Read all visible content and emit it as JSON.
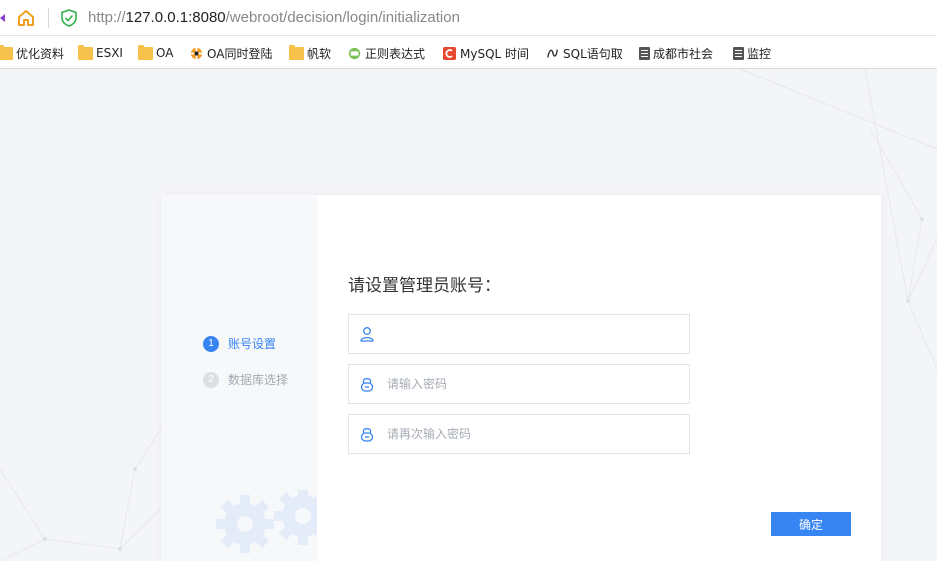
{
  "browser": {
    "url_prefix": "http://",
    "url_host": "127.0.0.1:8080",
    "url_path": "/webroot/decision/login/initialization"
  },
  "bookmarks": [
    {
      "label": "优化资料",
      "icon": "folder-icon"
    },
    {
      "label": "ESXI",
      "icon": "folder-icon"
    },
    {
      "label": "OA",
      "icon": "folder-icon"
    },
    {
      "label": "OA同时登陆",
      "icon": "oa-logo-icon"
    },
    {
      "label": "帆软",
      "icon": "folder-icon"
    },
    {
      "label": "正则表达式",
      "icon": "regex-logo-icon"
    },
    {
      "label": "MySQL 时间",
      "icon": "c-logo-icon"
    },
    {
      "label": "SQL语句取",
      "icon": "sql-logo-icon"
    },
    {
      "label": "成都市社会",
      "icon": "document-icon"
    },
    {
      "label": "监控",
      "icon": "document-icon"
    }
  ],
  "steps": [
    {
      "number": "1",
      "label": "账号设置",
      "state": "active"
    },
    {
      "number": "2",
      "label": "数据库选择",
      "state": "inactive"
    }
  ],
  "form": {
    "heading": "请设置管理员账号：",
    "username": {
      "value": "",
      "placeholder": ""
    },
    "password": {
      "value": "",
      "placeholder": "请输入密码"
    },
    "confirm_password": {
      "value": "",
      "placeholder": "请再次输入密码"
    },
    "confirm_button": "确定"
  },
  "colors": {
    "accent": "#3685f2",
    "step_inactive": "#a4a9b2",
    "page_background": "#f4f5f9"
  }
}
